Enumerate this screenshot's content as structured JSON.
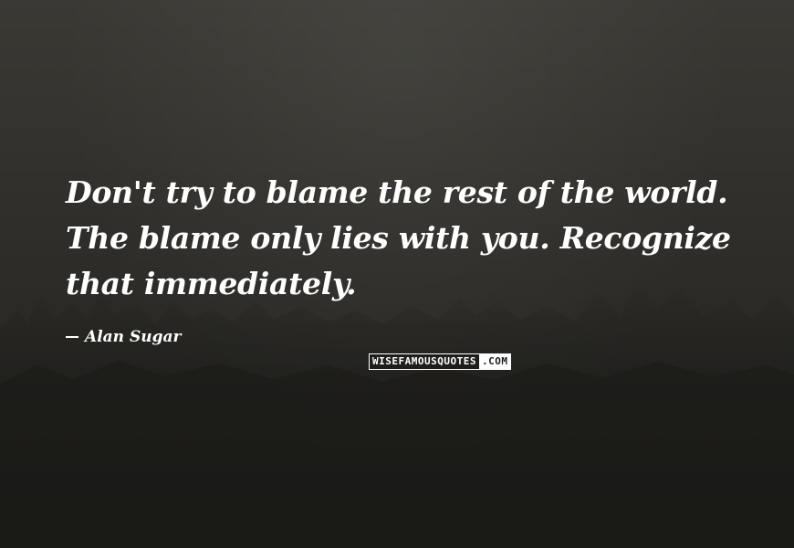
{
  "quote": {
    "text": "Don't try to blame the rest of the world. The blame only lies with you. Recognize that immediately."
  },
  "author": {
    "name": "Alan Sugar"
  },
  "watermark": {
    "left_text": "WISEFAMOUSQUOTES",
    "right_text": ".COM"
  },
  "colors": {
    "text": "#ffffff",
    "background": "#2e2d29"
  }
}
